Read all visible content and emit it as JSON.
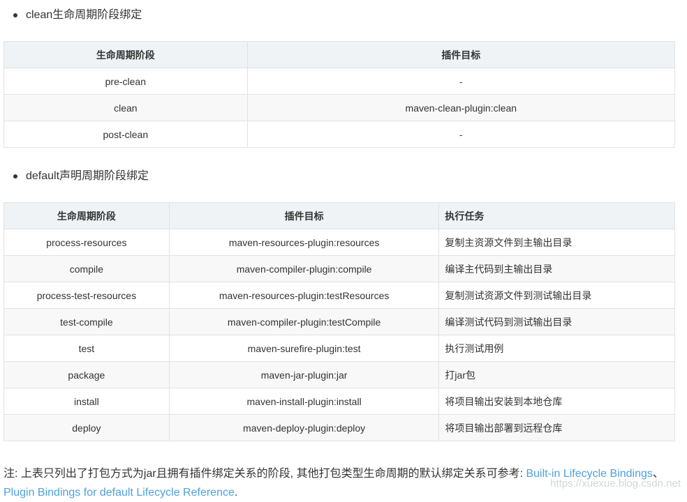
{
  "section1": {
    "bullet": "clean生命周期阶段绑定",
    "headers": [
      "生命周期阶段",
      "插件目标"
    ],
    "rows": [
      [
        "pre-clean",
        "-"
      ],
      [
        "clean",
        "maven-clean-plugin:clean"
      ],
      [
        "post-clean",
        "-"
      ]
    ]
  },
  "section2": {
    "bullet": "default声明周期阶段绑定",
    "headers": [
      "生命周期阶段",
      "插件目标",
      "执行任务"
    ],
    "rows": [
      [
        "process-resources",
        "maven-resources-plugin:resources",
        "复制主资源文件到主输出目录"
      ],
      [
        "compile",
        "maven-compiler-plugin:compile",
        "编译主代码到主输出目录"
      ],
      [
        "process-test-resources",
        "maven-resources-plugin:testResources",
        "复制测试资源文件到测试输出目录"
      ],
      [
        "test-compile",
        "maven-compiler-plugin:testCompile",
        "编译测试代码到测试输出目录"
      ],
      [
        "test",
        "maven-surefire-plugin:test",
        "执行测试用例"
      ],
      [
        "package",
        "maven-jar-plugin:jar",
        "打jar包"
      ],
      [
        "install",
        "maven-install-plugin:install",
        "将项目输出安装到本地仓库"
      ],
      [
        "deploy",
        "maven-deploy-plugin:deploy",
        "将项目输出部署到远程仓库"
      ]
    ]
  },
  "note": {
    "text": "注: 上表只列出了打包方式为jar且拥有插件绑定关系的阶段, 其他打包类型生命周期的默认绑定关系可参考: ",
    "link1": "Built-in Lifecycle Bindings",
    "separator": "、",
    "link2": "Plugin Bindings for default Lifecycle Reference",
    "end": "."
  },
  "watermark": "https://xuexue.blog.csdn.net",
  "colors": {
    "link": "#4ea1db",
    "header_bg": "#eff3f5",
    "stripe_bg": "#f8f8f8",
    "border": "#dfe2e5"
  }
}
